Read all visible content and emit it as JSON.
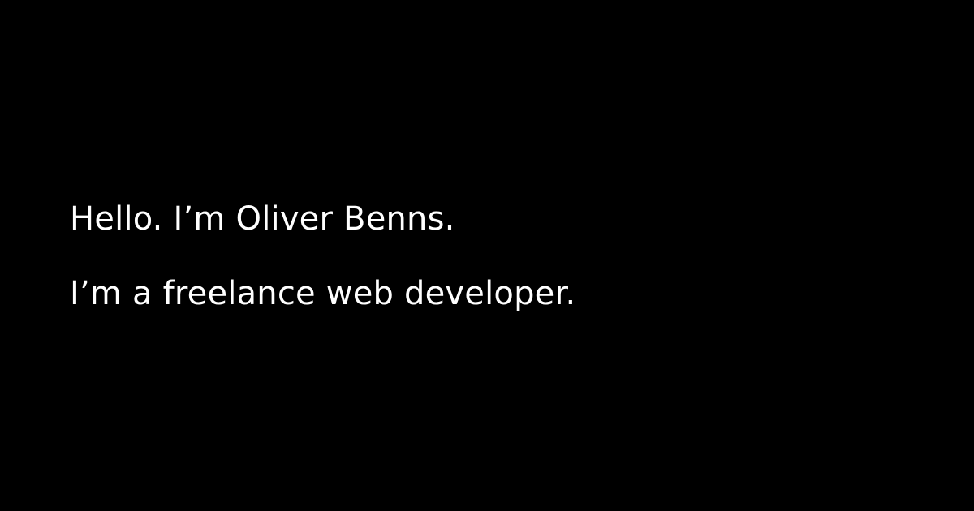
{
  "colors": {
    "background": "#000000",
    "text": "#ffffff"
  },
  "intro": {
    "greeting": "Hello. I’m Oliver Benns.",
    "tagline": "I’m a freelance web developer."
  }
}
